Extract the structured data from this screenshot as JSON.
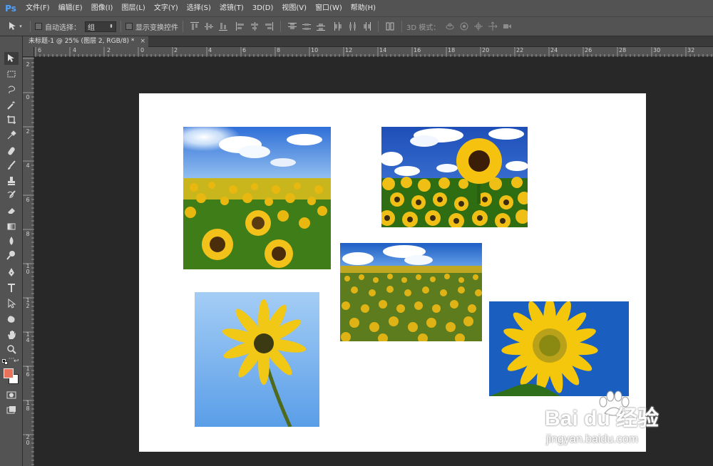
{
  "app": {
    "logo": "Ps"
  },
  "menu": [
    "文件(F)",
    "编辑(E)",
    "图像(I)",
    "图层(L)",
    "文字(Y)",
    "选择(S)",
    "滤镜(T)",
    "3D(D)",
    "视图(V)",
    "窗口(W)",
    "帮助(H)"
  ],
  "options": {
    "auto_select_label": "自动选择：",
    "auto_select_value": "组",
    "show_transform_label": "显示变换控件",
    "mode_3d_label": "3D 模式："
  },
  "document": {
    "tab_title": "未标题-1 @ 25% (图层 2, RGB/8) *",
    "close_glyph": "×"
  },
  "ruler_top": [
    "6",
    "4",
    "2",
    "0",
    "2",
    "4",
    "6",
    "8",
    "10",
    "12",
    "14",
    "16",
    "18",
    "20",
    "22",
    "24",
    "26",
    "28",
    "30",
    "32"
  ],
  "ruler_left": [
    "2",
    "0",
    "2",
    "4",
    "6",
    "8",
    "1 0",
    "1 2",
    "1 4",
    "1 6",
    "1 8",
    "2 0"
  ],
  "colors": {
    "foreground": "#e8735a",
    "background": "#ffffff",
    "ui_panel": "#535353",
    "workspace": "#282828"
  },
  "tools": [
    "move-tool",
    "marquee-tool",
    "lasso-tool",
    "magic-wand-tool",
    "crop-tool",
    "eyedropper-tool",
    "healing-brush-tool",
    "brush-tool",
    "clone-stamp-tool",
    "history-brush-tool",
    "eraser-tool",
    "gradient-tool",
    "blur-tool",
    "dodge-tool",
    "pen-tool",
    "type-tool",
    "path-selection-tool",
    "shape-tool",
    "hand-tool",
    "zoom-tool"
  ],
  "photos": [
    {
      "name": "sunflower-field-sun"
    },
    {
      "name": "sunflower-single-over-field"
    },
    {
      "name": "sunflower-field-wide"
    },
    {
      "name": "sunflower-sky-closeup"
    },
    {
      "name": "sunflower-blue-closeup"
    }
  ],
  "watermark": {
    "brand": "Bai du 经验",
    "url": "jingyan.baidu.com"
  }
}
